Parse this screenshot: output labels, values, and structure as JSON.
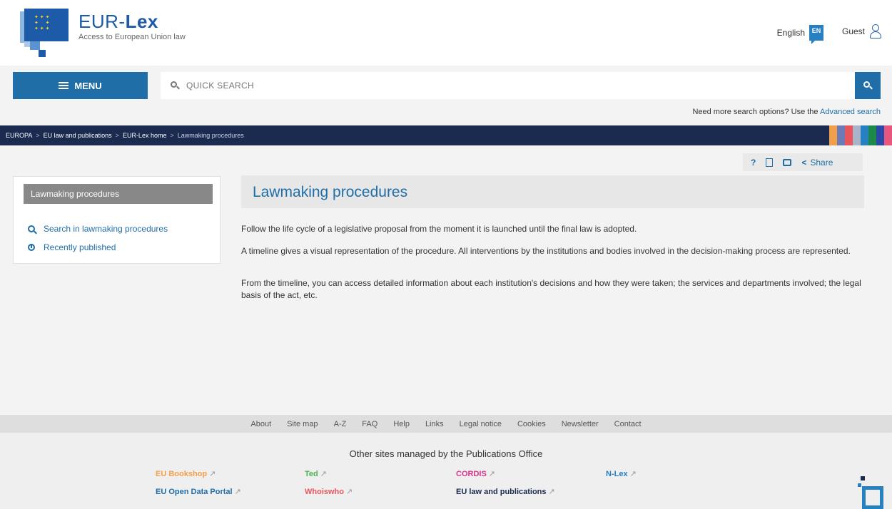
{
  "header": {
    "brand_prefix": "EUR-",
    "brand_bold": "Lex",
    "tagline": "Access to European Union law",
    "language": "English",
    "language_code": "EN",
    "user": "Guest"
  },
  "search": {
    "menu_label": "MENU",
    "placeholder": "QUICK SEARCH",
    "advanced_prefix": "Need more search options? Use the",
    "advanced_link": "Advanced search"
  },
  "breadcrumb": [
    "EUROPA",
    "EU law and publications",
    "EUR-Lex home",
    "Lawmaking procedures"
  ],
  "stripe_colors": [
    "#f29f4b",
    "#6a7bb8",
    "#e8555b",
    "#aab4c8",
    "#2680c2",
    "#1e8a4a",
    "#2b4aa8",
    "#e8557d"
  ],
  "tools": {
    "help": "?",
    "share": "Share"
  },
  "sidebar": {
    "title": "Lawmaking procedures",
    "items": [
      "Search in lawmaking procedures",
      "Recently published"
    ]
  },
  "main": {
    "title": "Lawmaking procedures",
    "paragraphs": [
      "Follow the life cycle of a legislative proposal from the moment it is launched until the final law is adopted.",
      "A timeline gives a visual representation of the procedure. All interventions by the institutions and bodies involved in the decision-making process are represented.",
      "From the timeline, you can access detailed information about each institution's decisions and how they were taken; the services and departments involved; the legal basis of the act, etc."
    ]
  },
  "footer": {
    "links": [
      "About",
      "Site map",
      "A-Z",
      "FAQ",
      "Help",
      "Links",
      "Legal notice",
      "Cookies",
      "Newsletter",
      "Contact"
    ],
    "heading": "Other sites managed by the Publications Office",
    "sites": [
      {
        "label": "EU Bookshop",
        "color": "#f29f4b"
      },
      {
        "label": "Ted",
        "color": "#4caf50"
      },
      {
        "label": "CORDIS",
        "color": "#d6338a"
      },
      {
        "label": "N-Lex",
        "color": "#2680c2"
      },
      {
        "label": "EU Open Data Portal",
        "color": "#1f6ea8"
      },
      {
        "label": "Whoiswho",
        "color": "#e8555b"
      },
      {
        "label": "EU law and publications",
        "color": "#1a2b4f"
      }
    ],
    "ext_icon": "↗"
  }
}
